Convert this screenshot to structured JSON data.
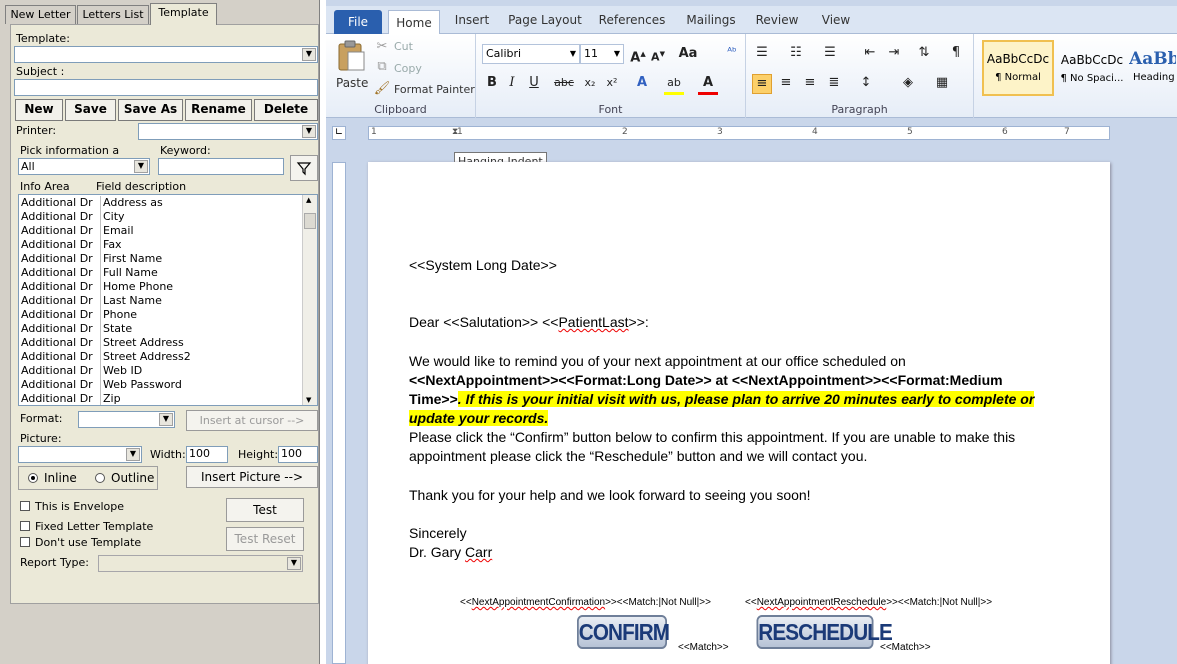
{
  "tabs": [
    "New Letter",
    "Letters List",
    "Template"
  ],
  "left": {
    "template_label": "Template:",
    "subject_label": "Subject :",
    "buttons": [
      "New",
      "Save",
      "Save As",
      "Rename",
      "Delete"
    ],
    "printer_label": "Printer:",
    "pick_label": "Pick information a",
    "keyword_label": "Keyword:",
    "pick_value": "All",
    "col_info": "Info Area",
    "col_field": "Field description",
    "rows": [
      {
        "area": "Additional Dr",
        "field": "Address as"
      },
      {
        "area": "Additional Dr",
        "field": "City"
      },
      {
        "area": "Additional Dr",
        "field": "Email"
      },
      {
        "area": "Additional Dr",
        "field": "Fax"
      },
      {
        "area": "Additional Dr",
        "field": "First Name"
      },
      {
        "area": "Additional Dr",
        "field": "Full Name"
      },
      {
        "area": "Additional Dr",
        "field": "Home Phone"
      },
      {
        "area": "Additional Dr",
        "field": "Last Name"
      },
      {
        "area": "Additional Dr",
        "field": "Phone"
      },
      {
        "area": "Additional Dr",
        "field": "State"
      },
      {
        "area": "Additional Dr",
        "field": "Street Address"
      },
      {
        "area": "Additional Dr",
        "field": "Street Address2"
      },
      {
        "area": "Additional Dr",
        "field": "Web ID"
      },
      {
        "area": "Additional Dr",
        "field": "Web Password"
      },
      {
        "area": "Additional Dr",
        "field": "Zip"
      }
    ],
    "format_label": "Format:",
    "insert_cursor": "Insert at cursor -->",
    "picture_label": "Picture:",
    "width_label": "Width:",
    "width_value": "100",
    "height_label": "Height:",
    "height_value": "100",
    "inline_label": "Inline",
    "outline_label": "Outline",
    "insert_picture": "Insert Picture -->",
    "envelope": "This is Envelope",
    "fixed": "Fixed Letter Template",
    "dont_use": "Don't use Template",
    "test": "Test",
    "test_reset": "Test Reset",
    "report_type": "Report Type:"
  },
  "word": {
    "tabs": [
      "File",
      "Home",
      "Insert",
      "Page Layout",
      "References",
      "Mailings",
      "Review",
      "View"
    ],
    "clipboard": {
      "paste": "Paste",
      "cut": "Cut",
      "copy": "Copy",
      "format_painter": "Format Painter",
      "label": "Clipboard"
    },
    "font": {
      "name": "Calibri",
      "size": "11",
      "label": "Font"
    },
    "paragraph_label": "Paragraph",
    "styles": [
      {
        "preview": "AaBbCcDc",
        "name": "¶ Normal"
      },
      {
        "preview": "AaBbCcDc",
        "name": "¶ No Spaci..."
      },
      {
        "preview": "AaBb",
        "name": "Heading"
      }
    ],
    "tooltip": "Hanging Indent",
    "ruler_numbers": [
      "1",
      "1",
      "2",
      "3",
      "4",
      "5",
      "6",
      "7"
    ],
    "doc": {
      "date": "<<System Long Date>>",
      "dear": "Dear <<Salutation>> <<",
      "patient_last": "PatientLast",
      "dear_end": ">>:",
      "p1": "We would like to remind you of your next appointment at our office scheduled on",
      "p2": "<<NextAppointment>><<Format:Long Date>> at <<NextAppointment>><<Format:Medium",
      "p3a": "Time>>",
      "p3b": ". If this is your initial visit with us, please plan to arrive 20 minutes early to complete or",
      "p4": "update your records.",
      "p5": "Please click the “Confirm” button below to confirm this appointment.  If you are unable to make this",
      "p6": "appointment please click the “Reschedule” button and we will contact you.",
      "p7": "Thank you for your help and we look forward to seeing you soon!",
      "p8": "Sincerely",
      "p9a": "Dr. Gary ",
      "p9b": "Carr",
      "merge1a": "<<",
      "merge1b": "NextAppointmentConfirmation",
      "merge1c": ">><<Match:|Not Null|>>",
      "merge2a": "<<",
      "merge2b": "NextAppointmentReschedule",
      "merge2c": ">><<Match:|Not Null|>>",
      "confirm": "CONFIRM",
      "reschedule": "RESCHEDULE",
      "match": "<<Match>>"
    }
  },
  "colors": {
    "panel": "#ebe9d8",
    "file_tab": "#2a5fae",
    "highlight": "#ffff00"
  }
}
